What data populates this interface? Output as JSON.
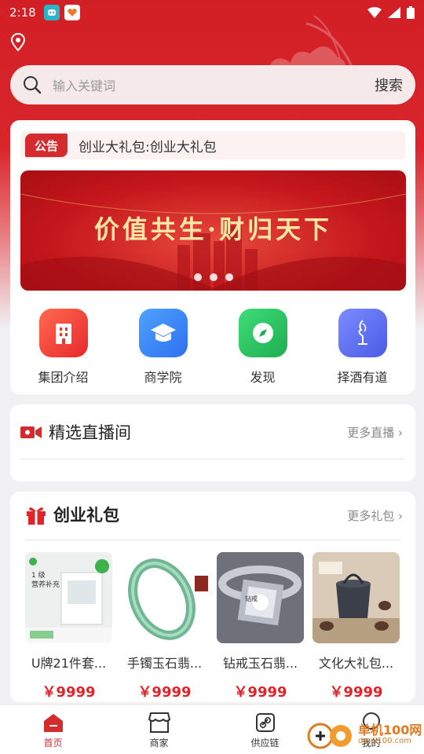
{
  "status_bar": {
    "time": "2:18"
  },
  "search": {
    "placeholder": "输入关键词",
    "button_label": "搜索"
  },
  "notice": {
    "badge": "公告",
    "text": "创业大礼包:创业大礼包"
  },
  "banner": {
    "slogan": "价值共生·财归天下",
    "dots": 3
  },
  "quick_links": [
    {
      "label": "集团介绍",
      "icon": "building-icon",
      "color": "#f04a3c"
    },
    {
      "label": "商学院",
      "icon": "graduation-cap-icon",
      "color": "#3a8cf5"
    },
    {
      "label": "发现",
      "icon": "compass-icon",
      "color": "#2bc361"
    },
    {
      "label": "择酒有道",
      "icon": "wine-logo-icon",
      "color": "#5a6bf0"
    }
  ],
  "live_section": {
    "title": "精选直播间",
    "more": "更多直播"
  },
  "gift_section": {
    "title": "创业礼包",
    "more": "更多礼包",
    "products": [
      {
        "name": "U牌21件套...",
        "price": "￥9999"
      },
      {
        "name": "手镯玉石翡...",
        "price": "￥9999"
      },
      {
        "name": "钻戒玉石翡...",
        "price": "￥9999"
      },
      {
        "name": "文化大礼包...",
        "price": "￥9999"
      }
    ]
  },
  "bottom_nav": [
    {
      "label": "首页",
      "icon": "home-icon",
      "active": true
    },
    {
      "label": "商家",
      "icon": "store-icon",
      "active": false
    },
    {
      "label": "供应链",
      "icon": "link-icon",
      "active": false
    },
    {
      "label": "我的",
      "icon": "user-icon",
      "active": false
    }
  ],
  "watermark": {
    "text": "单机100网",
    "sub": "danji100.com"
  },
  "colors": {
    "brand_red": "#d42b2f",
    "price_red": "#e0242a"
  }
}
